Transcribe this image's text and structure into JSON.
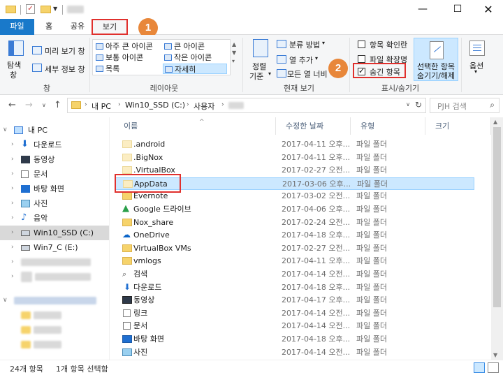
{
  "tabs": {
    "file": "파일",
    "home": "홈",
    "share": "공유",
    "view": "보기"
  },
  "badges": {
    "one": "1",
    "two": "2"
  },
  "ribbon": {
    "panes": {
      "nav_pane_1": "탐색",
      "nav_pane_2": "창",
      "preview": "미리 보기 창",
      "details_pane": "세부 정보 창",
      "group_label": "창"
    },
    "layout": {
      "extra_large": "아주 큰 아이콘",
      "large": "큰 아이콘",
      "medium": "보통 아이콘",
      "small": "작은 아이콘",
      "list": "목록",
      "details": "자세히",
      "group_label": "레이아웃"
    },
    "current_view": {
      "sort_1": "정렬",
      "sort_2": "기준",
      "group_by": "분류 방법",
      "add_column": "열 추가",
      "size_all_columns": "모든 열 너비",
      "group_label": "현재 보기"
    },
    "show_hide": {
      "item_checkboxes": "항목 확인란",
      "file_extensions": "파일 확장명",
      "hidden_items": "숨긴 항목",
      "hide_selected_1": "선택한 항목",
      "hide_selected_2": "숨기기/해제",
      "group_label": "표시/숨기기"
    },
    "options": "옵션"
  },
  "address": {
    "crumbs": [
      "내 PC",
      "Win10_SSD (C:)",
      "사용자"
    ],
    "search_placeholder": "PJH 검색"
  },
  "nav": [
    "내 PC",
    "다운로드",
    "동영상",
    "문서",
    "바탕 화면",
    "사진",
    "음악",
    "Win10_SSD (C:)",
    "Win7_C (E:)"
  ],
  "columns": {
    "name": "이름",
    "date": "수정한 날짜",
    "type": "유형",
    "size": "크기"
  },
  "files": [
    {
      "name": ".android",
      "date": "2017-04-11 오후...",
      "type": "파일 폴더"
    },
    {
      "name": ".BigNox",
      "date": "2017-04-11 오후...",
      "type": "파일 폴더"
    },
    {
      "name": ".VirtualBox",
      "date": "2017-02-27 오전...",
      "type": "파일 폴더"
    },
    {
      "name": "AppData",
      "date": "2017-03-06 오후...",
      "type": "파일 폴더"
    },
    {
      "name": "Evernote",
      "date": "2017-03-02 오전...",
      "type": "파일 폴더"
    },
    {
      "name": "Google 드라이브",
      "date": "2017-04-06 오후...",
      "type": "파일 폴더"
    },
    {
      "name": "Nox_share",
      "date": "2017-02-24 오전...",
      "type": "파일 폴더"
    },
    {
      "name": "OneDrive",
      "date": "2017-04-18 오후...",
      "type": "파일 폴더"
    },
    {
      "name": "VirtualBox VMs",
      "date": "2017-02-27 오전...",
      "type": "파일 폴더"
    },
    {
      "name": "vmlogs",
      "date": "2017-04-11 오후...",
      "type": "파일 폴더"
    },
    {
      "name": "검색",
      "date": "2017-04-14 오전...",
      "type": "파일 폴더"
    },
    {
      "name": "다운로드",
      "date": "2017-04-18 오후...",
      "type": "파일 폴더"
    },
    {
      "name": "동영상",
      "date": "2017-04-17 오후...",
      "type": "파일 폴더"
    },
    {
      "name": "링크",
      "date": "2017-04-14 오전...",
      "type": "파일 폴더"
    },
    {
      "name": "문서",
      "date": "2017-04-14 오전...",
      "type": "파일 폴더"
    },
    {
      "name": "바탕 화면",
      "date": "2017-04-18 오후...",
      "type": "파일 폴더"
    },
    {
      "name": "사진",
      "date": "2017-04-14 오전...",
      "type": "파일 폴더"
    }
  ],
  "status": {
    "count": "24개 항목",
    "selected": "1개 항목 선택함"
  }
}
